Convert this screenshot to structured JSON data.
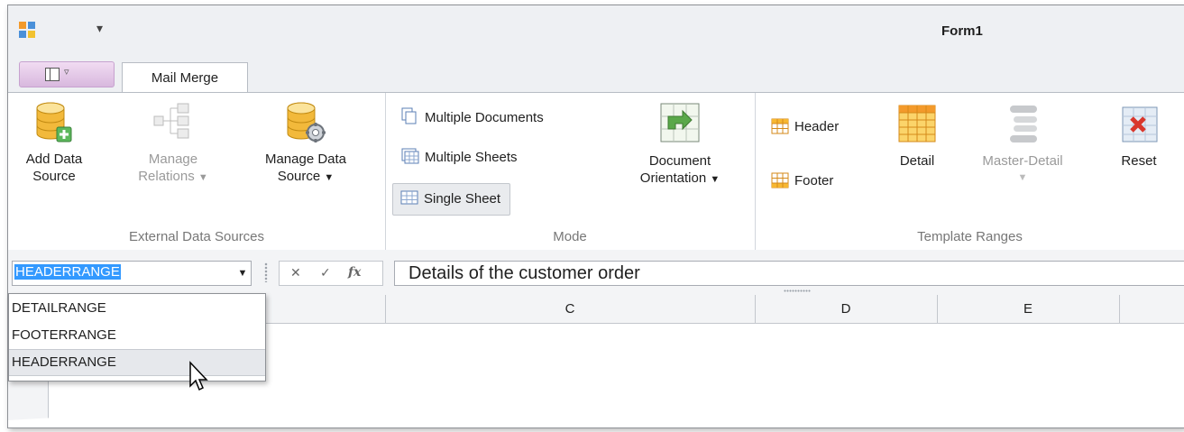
{
  "window": {
    "title": "Form1"
  },
  "tabs": [
    {
      "label": "Mail Merge"
    }
  ],
  "ribbon": {
    "external_group": {
      "label": "External Data Sources",
      "add_data_source": [
        "Add Data",
        "Source"
      ],
      "manage_relations": [
        "Manage",
        "Relations"
      ],
      "manage_data_source": [
        "Manage Data",
        "Source"
      ]
    },
    "mode_group": {
      "label": "Mode",
      "multiple_documents": "Multiple Documents",
      "multiple_sheets": "Multiple Sheets",
      "single_sheet": "Single Sheet",
      "document_orientation": [
        "Document",
        "Orientation"
      ]
    },
    "template_group": {
      "label": "Template Ranges",
      "header": "Header",
      "footer": "Footer",
      "detail": "Detail",
      "master_detail": "Master-Detail",
      "reset": "Reset"
    }
  },
  "formula_bar": {
    "name_box_value": "HEADERRANGE",
    "formula_value": "Details of the customer order"
  },
  "name_dropdown": {
    "items": [
      "DETAILRANGE",
      "FOOTERRANGE",
      "HEADERRANGE"
    ],
    "hovered": "HEADERRANGE"
  },
  "columns": [
    "C",
    "D",
    "E"
  ],
  "colors": {
    "selection": "#3399ff",
    "file_tab": "#e4c8e8"
  }
}
